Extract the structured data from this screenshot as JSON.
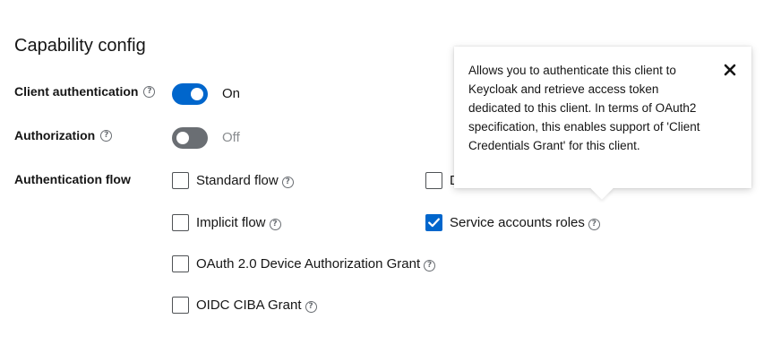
{
  "section": {
    "title": "Capability config"
  },
  "client_authentication": {
    "label": "Client authentication",
    "state_text": "On",
    "enabled": true
  },
  "authorization": {
    "label": "Authorization",
    "state_text": "Off",
    "enabled": false
  },
  "authentication_flow": {
    "label": "Authentication flow",
    "options": {
      "standard_flow": {
        "label": "Standard flow",
        "checked": false
      },
      "direct_access_peek": {
        "label": "D",
        "checked": false
      },
      "implicit_flow": {
        "label": "Implicit flow",
        "checked": false
      },
      "service_accounts_roles": {
        "label": "Service accounts roles",
        "checked": true
      },
      "oauth_device_grant": {
        "label": "OAuth 2.0 Device Authorization Grant",
        "checked": false
      },
      "oidc_ciba_grant": {
        "label": "OIDC CIBA Grant",
        "checked": false
      }
    }
  },
  "help_glyph": "?",
  "tooltip": {
    "text": "Allows you to authenticate this client to Keycloak and retrieve access token dedicated to this client. In terms of OAuth2 specification, this enables support of 'Client Credentials Grant' for this client.",
    "close_icon": "close-icon"
  },
  "colors": {
    "primary": "#0066cc",
    "switch_off": "#6a6e73",
    "text": "#151515",
    "muted": "#8a8d90"
  }
}
